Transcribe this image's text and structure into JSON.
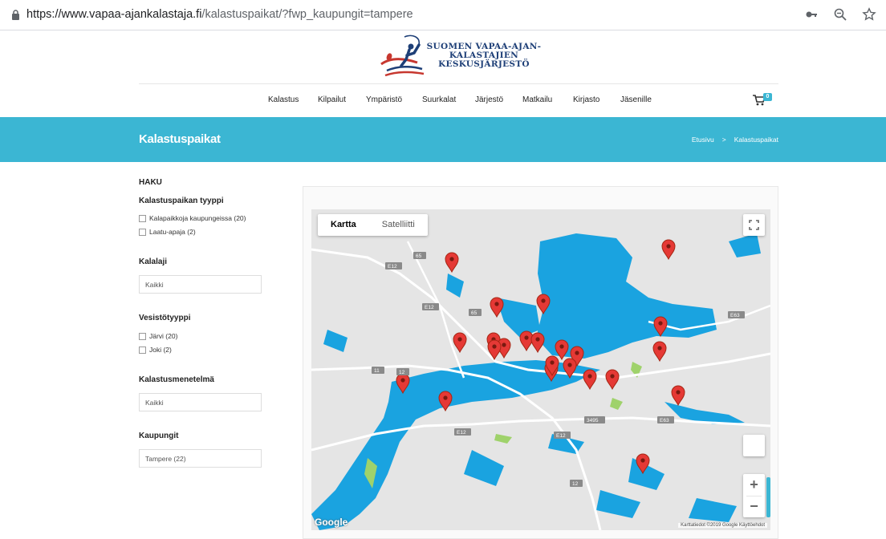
{
  "browser": {
    "url_host": "https://www.vapaa-ajankalastaja.fi",
    "url_path": "/kalastuspaikat/?fwp_kaupungit=tampere"
  },
  "logo": {
    "line1": "SUOMEN VAPAA-AJAN-",
    "line2": "KALASTAJIEN",
    "line3": "KESKUSJÄRJESTÖ"
  },
  "nav": {
    "items": [
      "Kalastus",
      "Kilpailut",
      "Ympäristö",
      "Suurkalat",
      "Järjestö",
      "Matkailu",
      "Kirjasto",
      "Jäsenille"
    ],
    "cart_count": "0"
  },
  "banner": {
    "title": "Kalastuspaikat",
    "crumb_home": "Etusivu",
    "crumb_sep": ">",
    "crumb_current": "Kalastuspaikat"
  },
  "sidebar": {
    "heading": "HAKU",
    "type_heading": "Kalastuspaikan tyyppi",
    "type_options": [
      "Kalapaikkoja kaupungeissa (20)",
      "Laatu-apaja (2)"
    ],
    "species_heading": "Kalalaji",
    "species_value": "Kaikki",
    "water_heading": "Vesistötyyppi",
    "water_options": [
      "Järvi (20)",
      "Joki (2)"
    ],
    "method_heading": "Kalastusmenetelmä",
    "method_value": "Kaikki",
    "city_heading": "Kaupungit",
    "city_value": "Tampere (22)"
  },
  "map": {
    "type_map": "Kartta",
    "type_satellite": "Satelliitti",
    "zoom_in": "+",
    "zoom_out": "−",
    "google": "Google",
    "attribution": "Karttatiedot ©2019 Google   Käyttöehdot",
    "marker_count": 23,
    "road_labels": [
      "E12",
      "65",
      "E12",
      "E63",
      "65",
      "11",
      "12",
      "3495",
      "E63",
      "E12",
      "E12",
      "12"
    ]
  },
  "colors": {
    "accent": "#3bb6d3",
    "water": "#1aa3e0",
    "marker": "#e53935"
  }
}
